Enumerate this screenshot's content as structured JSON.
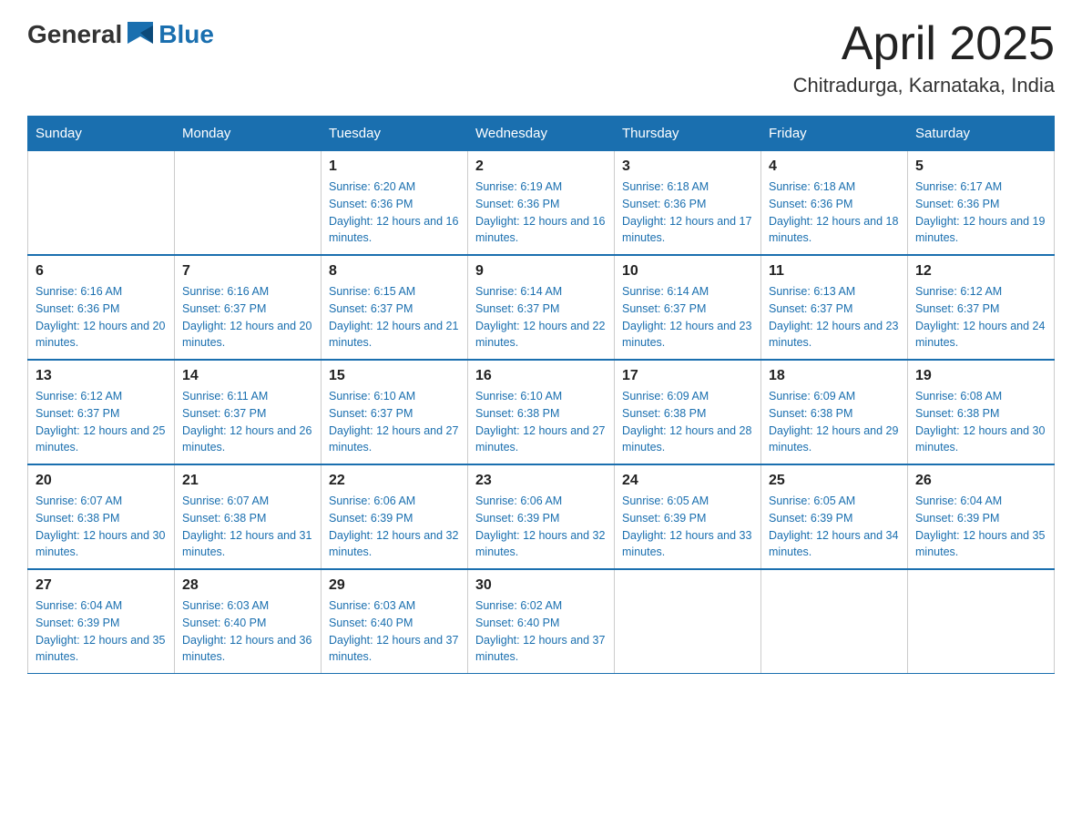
{
  "logo": {
    "text_general": "General",
    "text_blue": "Blue"
  },
  "title": {
    "month_year": "April 2025",
    "location": "Chitradurga, Karnataka, India"
  },
  "days_of_week": [
    "Sunday",
    "Monday",
    "Tuesday",
    "Wednesday",
    "Thursday",
    "Friday",
    "Saturday"
  ],
  "weeks": [
    [
      {
        "day": "",
        "sunrise": "",
        "sunset": "",
        "daylight": ""
      },
      {
        "day": "",
        "sunrise": "",
        "sunset": "",
        "daylight": ""
      },
      {
        "day": "1",
        "sunrise": "Sunrise: 6:20 AM",
        "sunset": "Sunset: 6:36 PM",
        "daylight": "Daylight: 12 hours and 16 minutes."
      },
      {
        "day": "2",
        "sunrise": "Sunrise: 6:19 AM",
        "sunset": "Sunset: 6:36 PM",
        "daylight": "Daylight: 12 hours and 16 minutes."
      },
      {
        "day": "3",
        "sunrise": "Sunrise: 6:18 AM",
        "sunset": "Sunset: 6:36 PM",
        "daylight": "Daylight: 12 hours and 17 minutes."
      },
      {
        "day": "4",
        "sunrise": "Sunrise: 6:18 AM",
        "sunset": "Sunset: 6:36 PM",
        "daylight": "Daylight: 12 hours and 18 minutes."
      },
      {
        "day": "5",
        "sunrise": "Sunrise: 6:17 AM",
        "sunset": "Sunset: 6:36 PM",
        "daylight": "Daylight: 12 hours and 19 minutes."
      }
    ],
    [
      {
        "day": "6",
        "sunrise": "Sunrise: 6:16 AM",
        "sunset": "Sunset: 6:36 PM",
        "daylight": "Daylight: 12 hours and 20 minutes."
      },
      {
        "day": "7",
        "sunrise": "Sunrise: 6:16 AM",
        "sunset": "Sunset: 6:37 PM",
        "daylight": "Daylight: 12 hours and 20 minutes."
      },
      {
        "day": "8",
        "sunrise": "Sunrise: 6:15 AM",
        "sunset": "Sunset: 6:37 PM",
        "daylight": "Daylight: 12 hours and 21 minutes."
      },
      {
        "day": "9",
        "sunrise": "Sunrise: 6:14 AM",
        "sunset": "Sunset: 6:37 PM",
        "daylight": "Daylight: 12 hours and 22 minutes."
      },
      {
        "day": "10",
        "sunrise": "Sunrise: 6:14 AM",
        "sunset": "Sunset: 6:37 PM",
        "daylight": "Daylight: 12 hours and 23 minutes."
      },
      {
        "day": "11",
        "sunrise": "Sunrise: 6:13 AM",
        "sunset": "Sunset: 6:37 PM",
        "daylight": "Daylight: 12 hours and 23 minutes."
      },
      {
        "day": "12",
        "sunrise": "Sunrise: 6:12 AM",
        "sunset": "Sunset: 6:37 PM",
        "daylight": "Daylight: 12 hours and 24 minutes."
      }
    ],
    [
      {
        "day": "13",
        "sunrise": "Sunrise: 6:12 AM",
        "sunset": "Sunset: 6:37 PM",
        "daylight": "Daylight: 12 hours and 25 minutes."
      },
      {
        "day": "14",
        "sunrise": "Sunrise: 6:11 AM",
        "sunset": "Sunset: 6:37 PM",
        "daylight": "Daylight: 12 hours and 26 minutes."
      },
      {
        "day": "15",
        "sunrise": "Sunrise: 6:10 AM",
        "sunset": "Sunset: 6:37 PM",
        "daylight": "Daylight: 12 hours and 27 minutes."
      },
      {
        "day": "16",
        "sunrise": "Sunrise: 6:10 AM",
        "sunset": "Sunset: 6:38 PM",
        "daylight": "Daylight: 12 hours and 27 minutes."
      },
      {
        "day": "17",
        "sunrise": "Sunrise: 6:09 AM",
        "sunset": "Sunset: 6:38 PM",
        "daylight": "Daylight: 12 hours and 28 minutes."
      },
      {
        "day": "18",
        "sunrise": "Sunrise: 6:09 AM",
        "sunset": "Sunset: 6:38 PM",
        "daylight": "Daylight: 12 hours and 29 minutes."
      },
      {
        "day": "19",
        "sunrise": "Sunrise: 6:08 AM",
        "sunset": "Sunset: 6:38 PM",
        "daylight": "Daylight: 12 hours and 30 minutes."
      }
    ],
    [
      {
        "day": "20",
        "sunrise": "Sunrise: 6:07 AM",
        "sunset": "Sunset: 6:38 PM",
        "daylight": "Daylight: 12 hours and 30 minutes."
      },
      {
        "day": "21",
        "sunrise": "Sunrise: 6:07 AM",
        "sunset": "Sunset: 6:38 PM",
        "daylight": "Daylight: 12 hours and 31 minutes."
      },
      {
        "day": "22",
        "sunrise": "Sunrise: 6:06 AM",
        "sunset": "Sunset: 6:39 PM",
        "daylight": "Daylight: 12 hours and 32 minutes."
      },
      {
        "day": "23",
        "sunrise": "Sunrise: 6:06 AM",
        "sunset": "Sunset: 6:39 PM",
        "daylight": "Daylight: 12 hours and 32 minutes."
      },
      {
        "day": "24",
        "sunrise": "Sunrise: 6:05 AM",
        "sunset": "Sunset: 6:39 PM",
        "daylight": "Daylight: 12 hours and 33 minutes."
      },
      {
        "day": "25",
        "sunrise": "Sunrise: 6:05 AM",
        "sunset": "Sunset: 6:39 PM",
        "daylight": "Daylight: 12 hours and 34 minutes."
      },
      {
        "day": "26",
        "sunrise": "Sunrise: 6:04 AM",
        "sunset": "Sunset: 6:39 PM",
        "daylight": "Daylight: 12 hours and 35 minutes."
      }
    ],
    [
      {
        "day": "27",
        "sunrise": "Sunrise: 6:04 AM",
        "sunset": "Sunset: 6:39 PM",
        "daylight": "Daylight: 12 hours and 35 minutes."
      },
      {
        "day": "28",
        "sunrise": "Sunrise: 6:03 AM",
        "sunset": "Sunset: 6:40 PM",
        "daylight": "Daylight: 12 hours and 36 minutes."
      },
      {
        "day": "29",
        "sunrise": "Sunrise: 6:03 AM",
        "sunset": "Sunset: 6:40 PM",
        "daylight": "Daylight: 12 hours and 37 minutes."
      },
      {
        "day": "30",
        "sunrise": "Sunrise: 6:02 AM",
        "sunset": "Sunset: 6:40 PM",
        "daylight": "Daylight: 12 hours and 37 minutes."
      },
      {
        "day": "",
        "sunrise": "",
        "sunset": "",
        "daylight": ""
      },
      {
        "day": "",
        "sunrise": "",
        "sunset": "",
        "daylight": ""
      },
      {
        "day": "",
        "sunrise": "",
        "sunset": "",
        "daylight": ""
      }
    ]
  ]
}
